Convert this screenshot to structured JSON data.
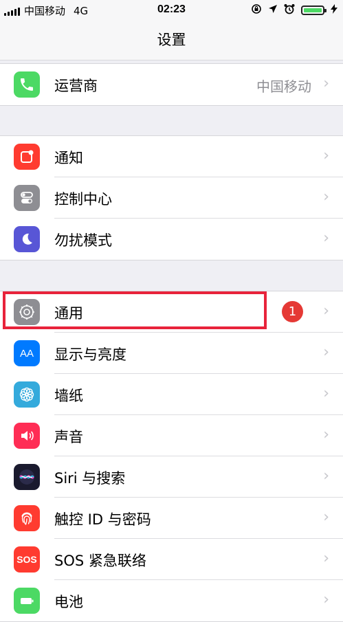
{
  "status_bar": {
    "carrier": "中国移动",
    "network": "4G",
    "time": "02:23",
    "battery_level": 1.0
  },
  "nav": {
    "title": "设置"
  },
  "groups": [
    {
      "rows": [
        {
          "label": "运营商",
          "value": "中国移动",
          "icon": "phone-icon",
          "icon_color": "#4cd964"
        }
      ]
    },
    {
      "rows": [
        {
          "label": "通知",
          "icon": "notifications-icon",
          "icon_color": "#ff3b30"
        },
        {
          "label": "控制中心",
          "icon": "control-center-icon",
          "icon_color": "#8e8e93"
        },
        {
          "label": "勿扰模式",
          "icon": "moon-icon",
          "icon_color": "#5856d6"
        }
      ]
    },
    {
      "rows": [
        {
          "label": "通用",
          "badge": "1",
          "icon": "gear-icon",
          "icon_color": "#8e8e93"
        },
        {
          "label": "显示与亮度",
          "icon": "display-icon",
          "icon_color": "#007aff",
          "icon_text": "AA"
        },
        {
          "label": "墙纸",
          "icon": "wallpaper-icon",
          "icon_color": "#34aadc"
        },
        {
          "label": "声音",
          "icon": "speaker-icon",
          "icon_color": "#ff2d55"
        },
        {
          "label": "Siri 与搜索",
          "icon": "siri-icon",
          "icon_color": "#1a1a2e"
        },
        {
          "label": "触控 ID 与密码",
          "icon": "fingerprint-icon",
          "icon_color": "#ff3b30"
        },
        {
          "label": "SOS 紧急联络",
          "icon": "sos-icon",
          "icon_color": "#ff3b30",
          "icon_text": "SOS"
        },
        {
          "label": "电池",
          "icon": "battery-icon",
          "icon_color": "#4cd964"
        }
      ]
    }
  ]
}
